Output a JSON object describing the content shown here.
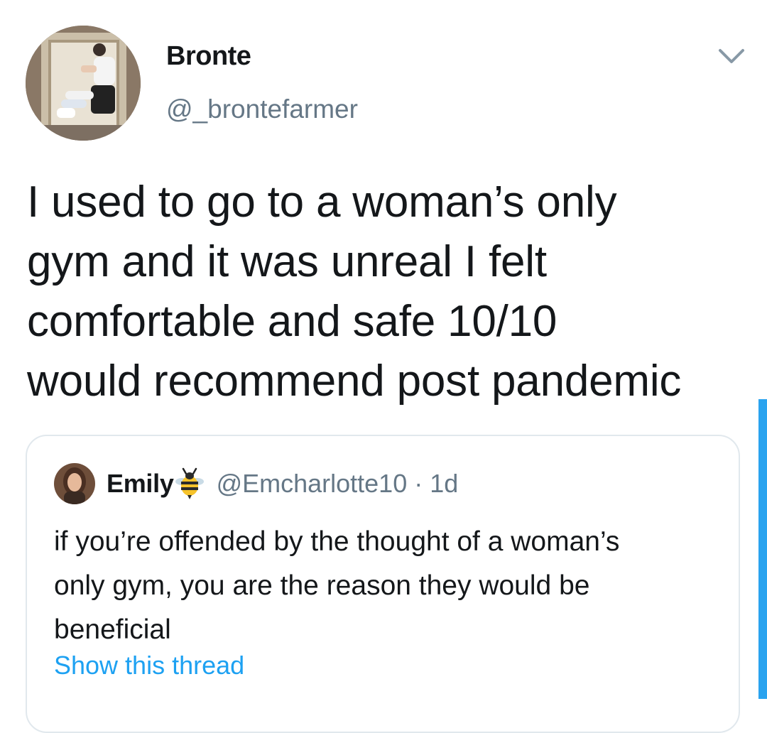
{
  "tweet": {
    "author": {
      "display_name": "Bronte",
      "handle": "@_brontefarmer"
    },
    "text_lines": [
      "I used to go to a woman’s only",
      "gym and it was unreal I felt",
      "comfortable and safe 10/10",
      "would recommend post pandemic"
    ],
    "menu_icon": "chevron-down-icon"
  },
  "quoted_tweet": {
    "author": {
      "display_name": "Emily",
      "emoji": "bee-icon",
      "handle": "@Emcharlotte10",
      "separator": "·",
      "time": "1d"
    },
    "text_lines": [
      "if you’re offended by the thought of a woman’s",
      "only gym, you are the reason they would be",
      "beneficial"
    ],
    "show_thread_label": "Show this thread"
  },
  "colors": {
    "text": "#14171a",
    "secondary": "#657786",
    "link": "#1da1f2",
    "border": "#e1e8ed",
    "scrollbar": "#2aa3ef"
  }
}
